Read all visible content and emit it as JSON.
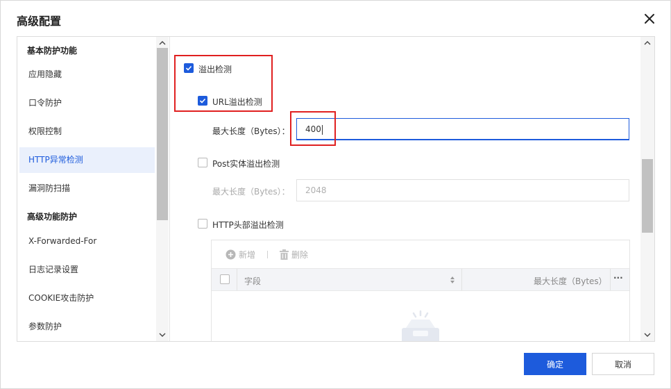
{
  "dialog": {
    "title": "高级配置"
  },
  "sidebar": {
    "groups": [
      {
        "label": "基本防护功能"
      },
      {
        "label": "高级功能防护"
      }
    ],
    "items": [
      {
        "label": "应用隐藏"
      },
      {
        "label": "口令防护"
      },
      {
        "label": "权限控制"
      },
      {
        "label": "HTTP异常检测",
        "active": true
      },
      {
        "label": "漏洞防扫描"
      },
      {
        "label": "X-Forwarded-For"
      },
      {
        "label": "日志记录设置"
      },
      {
        "label": "COOKIE攻击防护"
      },
      {
        "label": "参数防护"
      }
    ]
  },
  "content": {
    "overflow": {
      "label": "溢出检测",
      "checked": true
    },
    "url_overflow": {
      "label": "URL溢出检测",
      "checked": true,
      "max_len_label": "最大长度（Bytes）：",
      "max_len_value": "400"
    },
    "post_overflow": {
      "label": "Post实体溢出检测",
      "checked": false,
      "max_len_label": "最大长度（Bytes）：",
      "max_len_value": "2048"
    },
    "header_overflow": {
      "label": "HTTP头部溢出检测",
      "checked": false
    },
    "table": {
      "add_label": "新增",
      "delete_label": "删除",
      "col_field": "字段",
      "col_maxlen": "最大长度（Bytes）",
      "more": "···"
    }
  },
  "footer": {
    "ok_label": "确定",
    "cancel_label": "取消"
  },
  "colors": {
    "primary": "#1d5bdc",
    "highlight": "#e02020",
    "active_bg": "#eaf0fc"
  }
}
